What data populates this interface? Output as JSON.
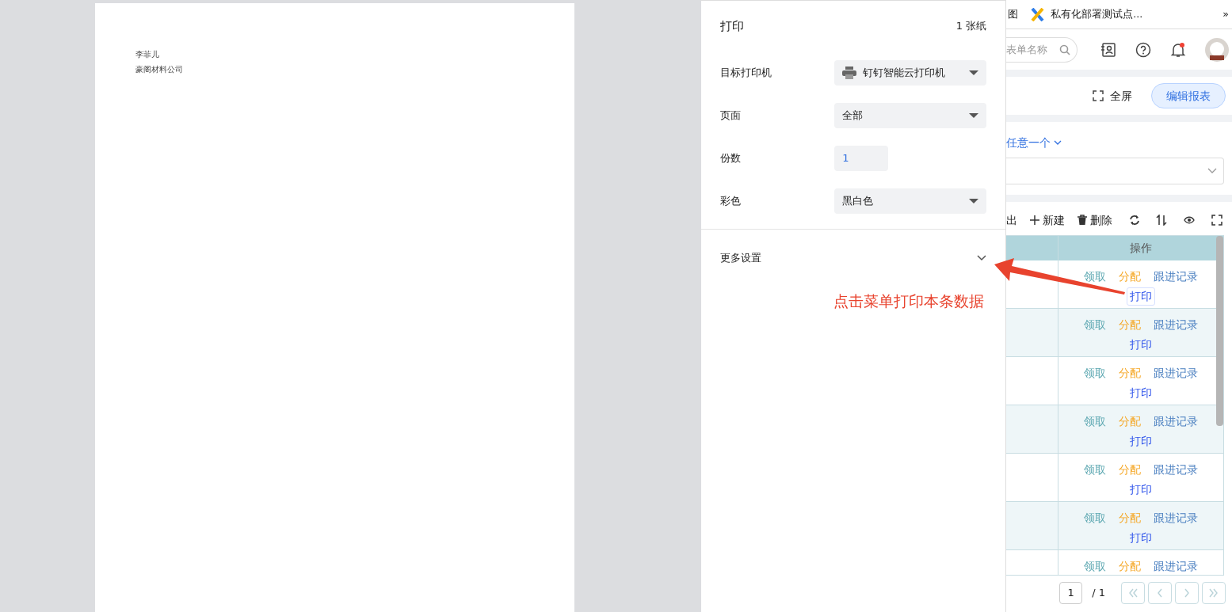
{
  "preview": {
    "lines": [
      "李菲儿",
      "豪阁材料公司"
    ]
  },
  "print_panel": {
    "title": "打印",
    "sheets": "1 张纸",
    "settings": [
      {
        "label": "目标打印机",
        "kind": "printer-select",
        "value": "钉钉智能云打印机"
      },
      {
        "label": "页面",
        "kind": "select",
        "value": "全部"
      },
      {
        "label": "份数",
        "kind": "number",
        "value": "1"
      },
      {
        "label": "彩色",
        "kind": "select",
        "value": "黑白色"
      }
    ],
    "more_settings": {
      "label": "更多设置",
      "expanded": false
    }
  },
  "bookmarks": [
    {
      "label": "图",
      "kind": "plain"
    },
    {
      "label": "私有化部署测试点...",
      "kind": "app"
    }
  ],
  "bookmarks_overflow": "»",
  "header": {
    "search_placeholder": "表单名称"
  },
  "report_bar": {
    "fullscreen": "全屏",
    "edit": "编辑报表"
  },
  "filter": {
    "link": "任意一个"
  },
  "toolbar": [
    {
      "kind": "text",
      "label": "出"
    },
    {
      "kind": "add",
      "label": "新建"
    },
    {
      "kind": "delete",
      "label": "删除"
    },
    {
      "kind": "refresh"
    },
    {
      "kind": "sort"
    },
    {
      "kind": "view"
    },
    {
      "kind": "fullscreen"
    }
  ],
  "table": {
    "columns": [
      "操作"
    ],
    "rows": [
      {
        "actions": [
          {
            "label": "领取",
            "color": "#5aa6b0"
          },
          {
            "label": "分配",
            "color": "#f5a623"
          },
          {
            "label": "跟进记录",
            "color": "#4a7fc0"
          },
          {
            "label": "打印",
            "color": "#2f54eb",
            "focused": true
          }
        ]
      },
      {
        "actions": [
          {
            "label": "领取",
            "color": "#5aa6b0"
          },
          {
            "label": "分配",
            "color": "#f5a623"
          },
          {
            "label": "跟进记录",
            "color": "#4a7fc0"
          },
          {
            "label": "打印",
            "color": "#2f54eb",
            "focused": false
          }
        ]
      },
      {
        "actions": [
          {
            "label": "领取",
            "color": "#5aa6b0"
          },
          {
            "label": "分配",
            "color": "#f5a623"
          },
          {
            "label": "跟进记录",
            "color": "#4a7fc0"
          },
          {
            "label": "打印",
            "color": "#2f54eb",
            "focused": false
          }
        ]
      },
      {
        "actions": [
          {
            "label": "领取",
            "color": "#5aa6b0"
          },
          {
            "label": "分配",
            "color": "#f5a623"
          },
          {
            "label": "跟进记录",
            "color": "#4a7fc0"
          },
          {
            "label": "打印",
            "color": "#2f54eb",
            "focused": false
          }
        ]
      },
      {
        "actions": [
          {
            "label": "领取",
            "color": "#5aa6b0"
          },
          {
            "label": "分配",
            "color": "#f5a623"
          },
          {
            "label": "跟进记录",
            "color": "#4a7fc0"
          },
          {
            "label": "打印",
            "color": "#2f54eb",
            "focused": false
          }
        ]
      },
      {
        "actions": [
          {
            "label": "领取",
            "color": "#5aa6b0"
          },
          {
            "label": "分配",
            "color": "#f5a623"
          },
          {
            "label": "跟进记录",
            "color": "#4a7fc0"
          },
          {
            "label": "打印",
            "color": "#2f54eb",
            "focused": false
          }
        ]
      },
      {
        "actions": [
          {
            "label": "领取",
            "color": "#5aa6b0"
          },
          {
            "label": "分配",
            "color": "#f5a623"
          },
          {
            "label": "跟进记录",
            "color": "#4a7fc0"
          }
        ]
      }
    ]
  },
  "pagination": {
    "page": "1",
    "total": "/ 1"
  },
  "annotation": {
    "text": "点击菜单打印本条数据"
  }
}
